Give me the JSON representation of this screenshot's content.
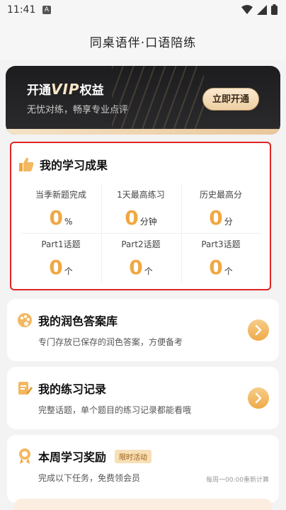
{
  "status": {
    "time": "11:41",
    "a_icon": "A"
  },
  "app": {
    "title": "同桌语伴·口语陪练"
  },
  "vip": {
    "title_prefix": "开通",
    "title_vip": "VIP",
    "title_suffix": "权益",
    "subtitle": "无忧对练，畅享专业点评",
    "button": "立即开通"
  },
  "achievements": {
    "title": "我的学习成果",
    "stats": [
      {
        "label": "当季新题完成",
        "value": "0",
        "unit": "%"
      },
      {
        "label": "1天最高练习",
        "value": "0",
        "unit": "分钟"
      },
      {
        "label": "历史最高分",
        "value": "0",
        "unit": "分"
      },
      {
        "label": "Part1话题",
        "value": "0",
        "unit": "个"
      },
      {
        "label": "Part2话题",
        "value": "0",
        "unit": "个"
      },
      {
        "label": "Part3话题",
        "value": "0",
        "unit": "个"
      }
    ]
  },
  "features": [
    {
      "title": "我的润色答案库",
      "subtitle": "专门存放已保存的润色答案，方便备考",
      "icon": "palette-icon"
    },
    {
      "title": "我的练习记录",
      "subtitle": "完整话题，单个题目的练习记录都能看哦",
      "icon": "note-edit-icon"
    }
  ],
  "reward": {
    "title": "本周学习奖励",
    "badge": "限时活动",
    "subtitle": "完成以下任务，免费领会员",
    "reset_note": "每周一00:00重新计算"
  },
  "colors": {
    "accent": "#f0a843",
    "highlight_border": "#e02424"
  }
}
